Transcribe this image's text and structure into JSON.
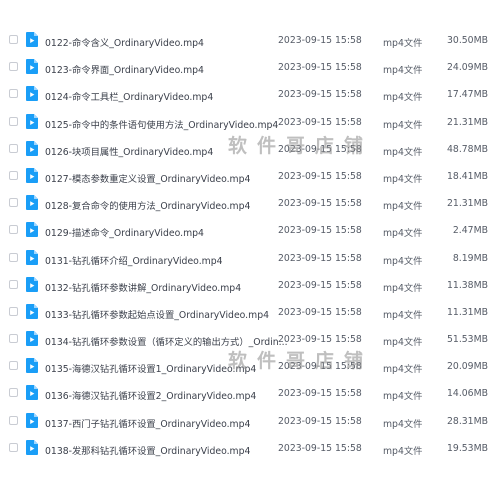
{
  "files": [
    {
      "name": "0122-命令含义_OrdinaryVideo.mp4",
      "date": "2023-09-15 15:58",
      "type": "mp4文件",
      "size": "30.50MB"
    },
    {
      "name": "0123-命令界面_OrdinaryVideo.mp4",
      "date": "2023-09-15 15:58",
      "type": "mp4文件",
      "size": "24.09MB"
    },
    {
      "name": "0124-命令工具栏_OrdinaryVideo.mp4",
      "date": "2023-09-15 15:58",
      "type": "mp4文件",
      "size": "17.47MB"
    },
    {
      "name": "0125-命令中的条件语句使用方法_OrdinaryVideo.mp4",
      "date": "2023-09-15 15:58",
      "type": "mp4文件",
      "size": "21.31MB"
    },
    {
      "name": "0126-块项目属性_OrdinaryVideo.mp4",
      "date": "2023-09-15 15:58",
      "type": "mp4文件",
      "size": "48.78MB"
    },
    {
      "name": "0127-模态参数重定义设置_OrdinaryVideo.mp4",
      "date": "2023-09-15 15:58",
      "type": "mp4文件",
      "size": "18.41MB"
    },
    {
      "name": "0128-复合命令的使用方法_OrdinaryVideo.mp4",
      "date": "2023-09-15 15:58",
      "type": "mp4文件",
      "size": "21.31MB"
    },
    {
      "name": "0129-描述命令_OrdinaryVideo.mp4",
      "date": "2023-09-15 15:58",
      "type": "mp4文件",
      "size": "2.47MB"
    },
    {
      "name": "0131-钻孔循环介绍_OrdinaryVideo.mp4",
      "date": "2023-09-15 15:58",
      "type": "mp4文件",
      "size": "8.19MB"
    },
    {
      "name": "0132-钻孔循环参数讲解_OrdinaryVideo.mp4",
      "date": "2023-09-15 15:58",
      "type": "mp4文件",
      "size": "11.38MB"
    },
    {
      "name": "0133-钻孔循环参数起始点设置_OrdinaryVideo.mp4",
      "date": "2023-09-15 15:58",
      "type": "mp4文件",
      "size": "11.31MB"
    },
    {
      "name": "0134-钻孔循环参数设置（循环定义的输出方式）_Ordin...",
      "date": "2023-09-15 15:58",
      "type": "mp4文件",
      "size": "51.53MB"
    },
    {
      "name": "0135-海德汉钻孔循环设置1_OrdinaryVideo.mp4",
      "date": "2023-09-15 15:58",
      "type": "mp4文件",
      "size": "20.09MB"
    },
    {
      "name": "0136-海德汉钻孔循环设置2_OrdinaryVideo.mp4",
      "date": "2023-09-15 15:58",
      "type": "mp4文件",
      "size": "14.06MB"
    },
    {
      "name": "0137-西门子钻孔循环设置_OrdinaryVideo.mp4",
      "date": "2023-09-15 15:58",
      "type": "mp4文件",
      "size": "28.31MB"
    },
    {
      "name": "0138-发那科钻孔循环设置_OrdinaryVideo.mp4",
      "date": "2023-09-15 15:58",
      "type": "mp4文件",
      "size": "19.53MB"
    }
  ],
  "watermarks": [
    "软件哥店铺",
    "软件哥店铺"
  ],
  "icon": {
    "name": "video-file-icon",
    "color": "#1a9ef7"
  }
}
